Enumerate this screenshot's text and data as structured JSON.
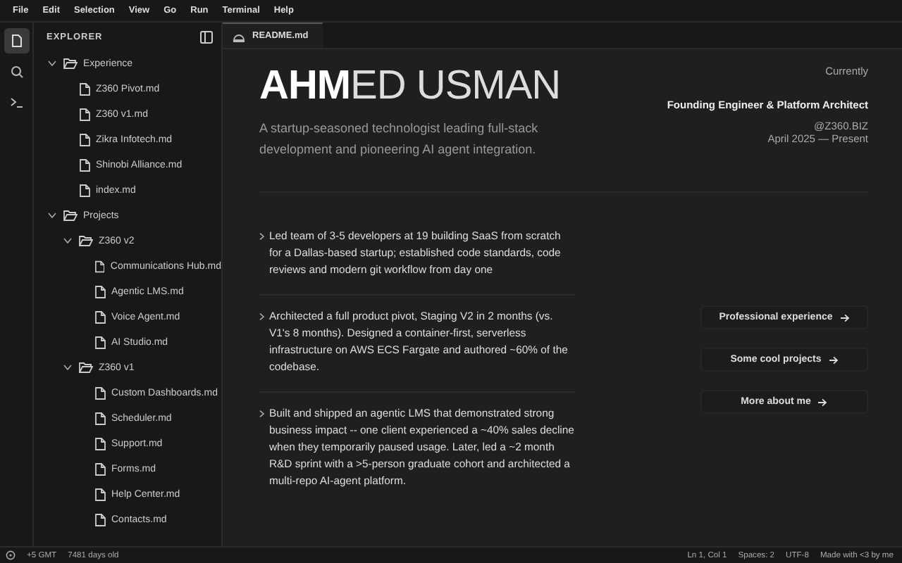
{
  "menu": [
    "File",
    "Edit",
    "Selection",
    "View",
    "Go",
    "Run",
    "Terminal",
    "Help"
  ],
  "activity_bar": [
    {
      "kind": "files",
      "selected": true
    },
    {
      "kind": "search",
      "selected": false
    },
    {
      "kind": "terminal",
      "selected": false
    }
  ],
  "explorer": {
    "title": "EXPLORER",
    "tree": [
      {
        "label": "Experience",
        "kind": "folder",
        "expanded": true,
        "children": [
          {
            "label": "Z360 Pivot.md",
            "kind": "file"
          },
          {
            "label": "Z360 v1.md",
            "kind": "file"
          },
          {
            "label": "Zikra Infotech.md",
            "kind": "file"
          },
          {
            "label": "Shinobi Alliance.md",
            "kind": "file"
          },
          {
            "label": "index.md",
            "kind": "file"
          }
        ]
      },
      {
        "label": "Projects",
        "kind": "folder",
        "expanded": true,
        "children": [
          {
            "label": "Z360 v2",
            "kind": "folder",
            "expanded": true,
            "children": [
              {
                "label": "Communications Hub.md",
                "kind": "file"
              },
              {
                "label": "Agentic LMS.md",
                "kind": "file"
              },
              {
                "label": "Voice Agent.md",
                "kind": "file"
              },
              {
                "label": "AI Studio.md",
                "kind": "file"
              }
            ]
          },
          {
            "label": "Z360 v1",
            "kind": "folder",
            "expanded": true,
            "children": [
              {
                "label": "Custom Dashboards.md",
                "kind": "file"
              },
              {
                "label": "Scheduler.md",
                "kind": "file"
              },
              {
                "label": "Support.md",
                "kind": "file"
              },
              {
                "label": "Forms.md",
                "kind": "file"
              },
              {
                "label": "Help Center.md",
                "kind": "file"
              },
              {
                "label": "Contacts.md",
                "kind": "file"
              }
            ]
          }
        ]
      }
    ]
  },
  "tabs": [
    {
      "label": "README.md",
      "selected": true
    }
  ],
  "readme": {
    "name": "**AHM**ED USMAN",
    "tagline": "A startup-seasoned technologist leading full-stack development and pioneering AI agent integration.",
    "current": {
      "label": "Currently",
      "role": "Founding Engineer & Platform Architect",
      "company": "@Z360.BIZ",
      "period": "April 2025 — Present"
    },
    "highlights": [
      "Led team of 3-5 developers at 19 building SaaS from scratch for a Dallas-based startup; established code standards, code reviews and modern git workflow from day one",
      "Architected a full product pivot, Staging V2 in 2 months (vs. V1's 8 months). Designed a container-first, serverless infrastructure on AWS ECS Fargate and authored ~60% of the codebase.",
      "Built and shipped an agentic LMS that demonstrated strong business impact -- one client experienced a ~40% sales decline when they temporarily paused usage. Later, led a ~2 month R&D sprint with a >5-person graduate cohort and architected a multi-repo AI-agent platform."
    ],
    "links": [
      "Professional experience",
      "Some cool projects",
      "More about me"
    ]
  },
  "status_bar": {
    "left": [
      "+5 GMT",
      "7481 days old"
    ],
    "right": [
      "Ln 1, Col 1",
      "Spaces: 2",
      "UTF-8",
      "Made with <3 by me"
    ]
  }
}
